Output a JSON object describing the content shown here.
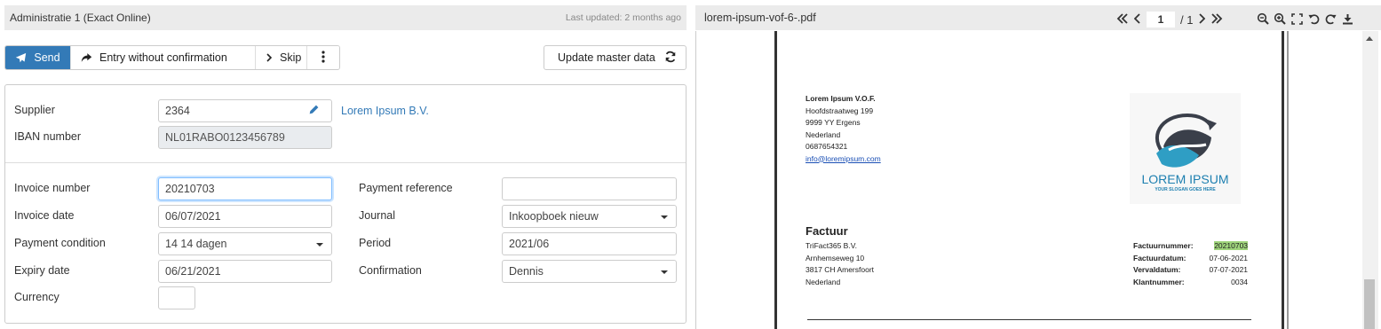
{
  "left": {
    "title": "Administratie 1 (Exact Online)",
    "last_updated": "Last updated: 2 months ago",
    "toolbar": {
      "send": "Send",
      "entry": "Entry without confirmation",
      "skip": "Skip"
    },
    "update_master": "Update master data",
    "supplier": {
      "label": "Supplier",
      "value": "2364",
      "name": "Lorem Ipsum B.V."
    },
    "iban": {
      "label": "IBAN number",
      "value": "NL01RABO0123456789"
    },
    "invoice_number": {
      "label": "Invoice number",
      "value": "20210703"
    },
    "invoice_date": {
      "label": "Invoice date",
      "value": "06/07/2021"
    },
    "payment_condition": {
      "label": "Payment condition",
      "value": "14 14 dagen"
    },
    "expiry_date": {
      "label": "Expiry date",
      "value": "06/21/2021"
    },
    "currency": {
      "label": "Currency",
      "value": ""
    },
    "payment_reference": {
      "label": "Payment reference",
      "value": ""
    },
    "journal": {
      "label": "Journal",
      "value": "Inkoopboek nieuw"
    },
    "period": {
      "label": "Period",
      "value": "2021/06"
    },
    "confirmation": {
      "label": "Confirmation",
      "value": "Dennis"
    }
  },
  "right": {
    "filename": "lorem-ipsum-vof-6-.pdf",
    "page": "1",
    "page_total": "/ 1",
    "pdf": {
      "sender": {
        "name": "Lorem Ipsum V.O.F.",
        "street": "Hoofdstraatweg 199",
        "zip": "9999 YY  Ergens",
        "country": "Nederland",
        "phone": "0687654321",
        "email": "info@loremipsum.com"
      },
      "logo": {
        "brand": "LOREM IPSUM",
        "slogan": "YOUR SLOGAN GOES HERE"
      },
      "heading": "Factuur",
      "recipient": {
        "name": "TriFact365 B.V.",
        "street": "Arnhemseweg 10",
        "zip": "3817 CH  Amersfoort",
        "country": "Nederland"
      },
      "meta": {
        "k1": "Factuurnummer:",
        "v1": "20210703",
        "k2": "Factuurdatum:",
        "v2": "07-06-2021",
        "k3": "Vervaldatum:",
        "v3": "07-07-2021",
        "k4": "Klantnummer:",
        "v4": "0034"
      }
    }
  },
  "colors": {
    "primary": "#337ab7",
    "highlight": "#9fd47c"
  }
}
